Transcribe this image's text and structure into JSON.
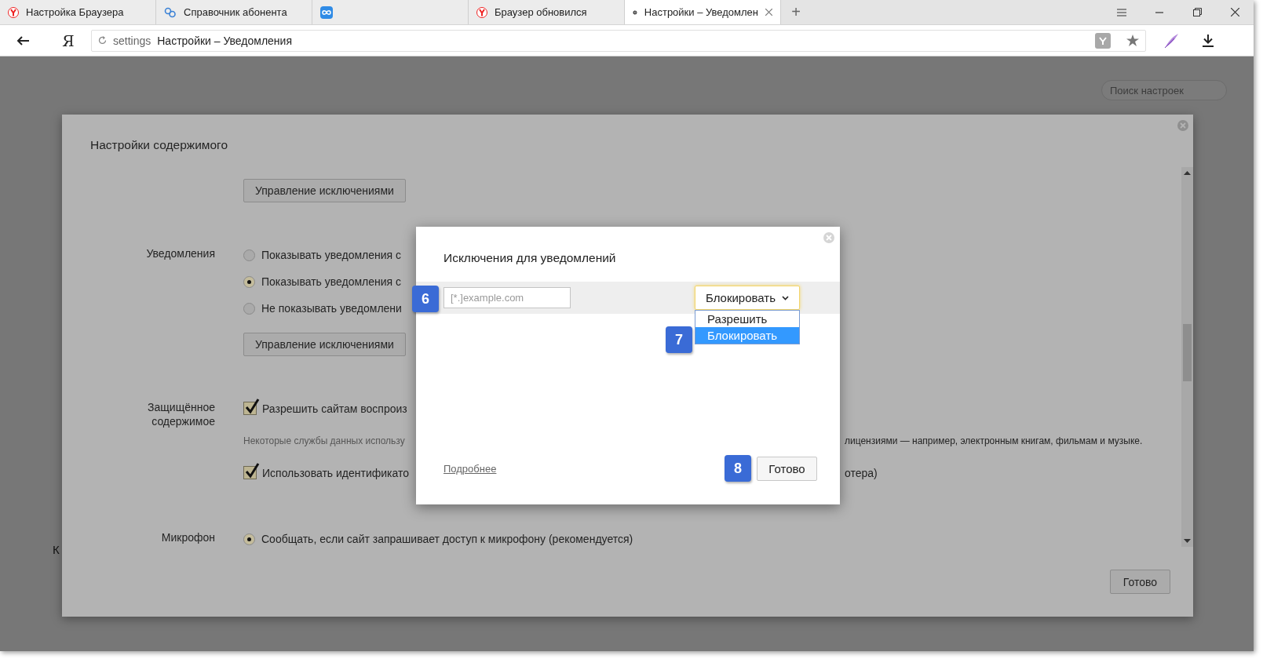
{
  "tabs": [
    {
      "title": "Настройка Браузера",
      "selected": false,
      "closable": false
    },
    {
      "title": "Справочник абонента",
      "selected": false,
      "closable": false
    },
    {
      "selected": false,
      "closable": false
    },
    {
      "title": "Браузер обновился",
      "selected": false,
      "closable": false
    },
    {
      "title": "Настройки – Уведомлен",
      "selected": true,
      "closable": true
    }
  ],
  "new_tab": "+",
  "address_bar": {
    "logo": "Я",
    "scheme": "settings",
    "title": "Настройки – Уведомления"
  },
  "search": {
    "placeholder": "Поиск настроек"
  },
  "background_text": "К",
  "content_settings": {
    "title": "Настройки содержимого",
    "sections": [
      {
        "items": [
          {
            "kind": "button",
            "text": "Управление исключениями"
          }
        ]
      },
      {
        "label": "Уведомления",
        "items": [
          {
            "kind": "radio",
            "text": "Показывать уведомления с",
            "selected": false
          },
          {
            "kind": "radio",
            "text": "Показывать уведомления с",
            "selected": true
          },
          {
            "kind": "radio",
            "text": "Не показывать уведомлени",
            "selected": false
          },
          {
            "kind": "button",
            "text": "Управление исключениями"
          }
        ]
      },
      {
        "label": "Защищённое содержимое",
        "items": [
          {
            "kind": "checkbox",
            "text": "Разрешить сайтам воспроиз",
            "checked": true
          },
          {
            "kind": "hint",
            "text": "Некоторые службы данных использу",
            "continued": "лицензиями — например, электронным книгам, фильмам и музыке."
          },
          {
            "kind": "checkbox",
            "text": "Использовать идентификато",
            "continued": "отера)",
            "checked": true
          }
        ]
      },
      {
        "label": "Микрофон",
        "items": [
          {
            "kind": "radio",
            "text": "Сообщать, если сайт запрашивает доступ к микрофону (рекомендуется)",
            "selected": true
          }
        ]
      }
    ],
    "done": "Готово"
  },
  "exceptions_dialog": {
    "title": "Исключения для уведомлений",
    "pattern_field": {
      "placeholder": "[*.]example.com"
    },
    "behavior_select": {
      "value": "Блокировать",
      "expanded": true,
      "options": [
        {
          "label": "Разрешить",
          "selected": false
        },
        {
          "label": "Блокировать",
          "selected": true
        }
      ]
    },
    "link": "Подробнее",
    "done": "Готово",
    "callouts": [
      {
        "text": "6",
        "kind": "field"
      },
      {
        "text": "7",
        "kind": "list"
      },
      {
        "text": "8",
        "kind": "done"
      }
    ]
  }
}
